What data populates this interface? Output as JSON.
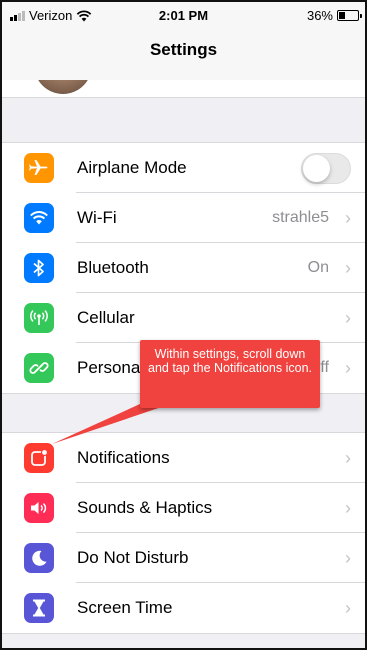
{
  "status_bar": {
    "carrier": "Verizon",
    "time": "2:01 PM",
    "battery_percent": "36%",
    "battery_level": 0.36
  },
  "nav": {
    "title": "Settings"
  },
  "group_1": [
    {
      "label": "Airplane Mode",
      "icon": "airplane-icon",
      "color": "#ff9500",
      "control": "toggle",
      "toggle_on": false
    },
    {
      "label": "Wi-Fi",
      "icon": "wifi-icon",
      "color": "#007aff",
      "value": "strahle5"
    },
    {
      "label": "Bluetooth",
      "icon": "bluetooth-icon",
      "color": "#007aff",
      "value": "On"
    },
    {
      "label": "Cellular",
      "icon": "cellular-antenna-icon",
      "color": "#34c759",
      "value": ""
    },
    {
      "label": "Personal Hotspot",
      "icon": "hotspot-link-icon",
      "color": "#34c759",
      "value": "Off"
    }
  ],
  "group_2": [
    {
      "label": "Notifications",
      "icon": "notifications-icon",
      "color": "#ff3b30"
    },
    {
      "label": "Sounds & Haptics",
      "icon": "speaker-icon",
      "color": "#ff2d55"
    },
    {
      "label": "Do Not Disturb",
      "icon": "moon-icon",
      "color": "#5856d6"
    },
    {
      "label": "Screen Time",
      "icon": "hourglass-icon",
      "color": "#5856d6"
    }
  ],
  "callout": {
    "text": "Within settings, scroll down and tap the Notifications icon.",
    "color": "#f0423e"
  }
}
